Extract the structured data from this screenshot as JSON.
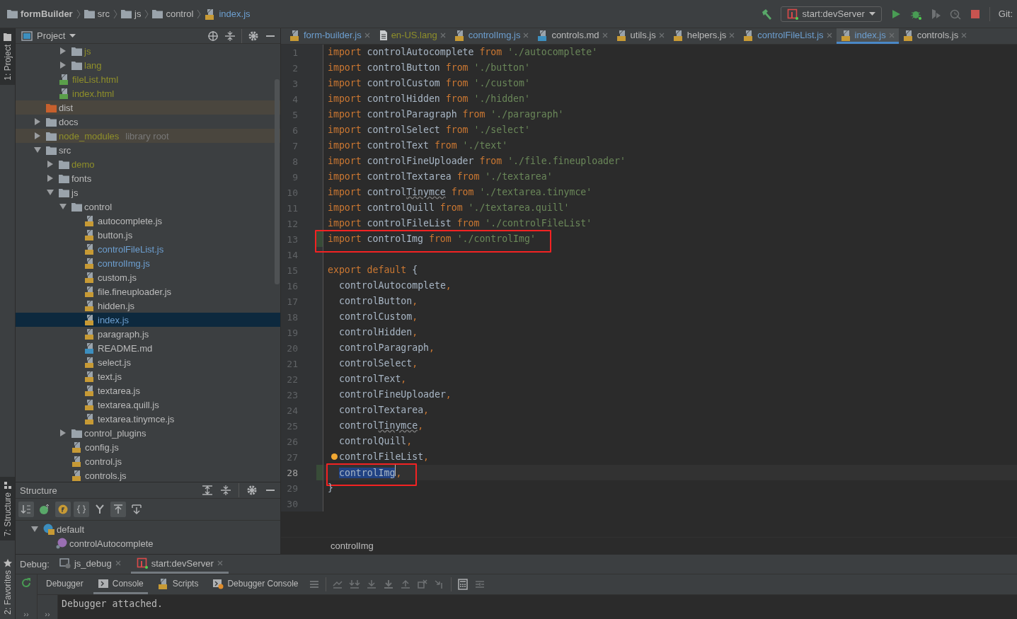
{
  "breadcrumbs": [
    {
      "label": "formBuilder",
      "kind": "project"
    },
    {
      "label": "src",
      "kind": "folder"
    },
    {
      "label": "js",
      "kind": "folder"
    },
    {
      "label": "control",
      "kind": "folder"
    },
    {
      "label": "index.js",
      "kind": "js"
    }
  ],
  "run_config": {
    "label": "start:devServer"
  },
  "vcs": {
    "label": "Git:"
  },
  "left_strip": {
    "top": [
      {
        "label": "1: Project",
        "selected": true
      }
    ],
    "bottom": [
      {
        "label": "7: Structure",
        "selected": true
      },
      {
        "label": "2: Favorites",
        "selected": false
      }
    ]
  },
  "project_panel": {
    "title": "Project",
    "tree": [
      {
        "children": [
          {
            "children": [
              {
                "label": "js",
                "kind": "folder",
                "color": "#8f8f2a",
                "expanded": false,
                "selected": false
              },
              {
                "label": "lang",
                "kind": "folder",
                "color": "#8f8f2a",
                "expanded": false,
                "selected": false
              }
            ]
          },
          {
            "label": "fileList.html",
            "kind": "html",
            "color": "#8f8f2a",
            "selected": false
          },
          {
            "label": "index.html",
            "kind": "html",
            "color": "#8f8f2a",
            "selected": false
          }
        ]
      },
      {
        "label": "dist",
        "kind": "output_folder",
        "color": "#bbbbbb",
        "excluded": true,
        "selected": false
      },
      {
        "label": "docs",
        "kind": "folder",
        "color": "#bbbbbb",
        "excluded": false,
        "expanded": false,
        "selected": false
      },
      {
        "label": "node_modules",
        "note": "library root",
        "kind": "folder",
        "color": "#8f8f2a",
        "excluded": true,
        "expanded": false,
        "selected": false
      },
      {
        "label": "src",
        "kind": "folder",
        "color": "#bbbbbb",
        "excluded": false,
        "expanded": true,
        "selected": false,
        "children": [
          {
            "label": "demo",
            "kind": "folder",
            "color": "#8f8f2a",
            "expanded": false,
            "selected": false
          },
          {
            "label": "fonts",
            "kind": "folder",
            "color": "#bbbbbb",
            "expanded": false,
            "selected": false
          },
          {
            "label": "js",
            "kind": "folder",
            "color": "#bbbbbb",
            "expanded": true,
            "selected": false,
            "children": [
              {
                "label": "control",
                "kind": "folder",
                "color": "#bbbbbb",
                "expanded": true,
                "selected": false,
                "children": [
                  {
                    "label": "autocomplete.js",
                    "kind": "js",
                    "color": "#bbbbbb",
                    "selected": false
                  },
                  {
                    "label": "button.js",
                    "kind": "js",
                    "color": "#bbbbbb",
                    "selected": false
                  },
                  {
                    "label": "controlFileList.js",
                    "kind": "js",
                    "color": "#6d9fd0",
                    "selected": false
                  },
                  {
                    "label": "controlImg.js",
                    "kind": "js",
                    "color": "#6d9fd0",
                    "selected": false
                  },
                  {
                    "label": "custom.js",
                    "kind": "js",
                    "color": "#bbbbbb",
                    "selected": false
                  },
                  {
                    "label": "file.fineuploader.js",
                    "kind": "js",
                    "color": "#bbbbbb",
                    "selected": false
                  },
                  {
                    "label": "hidden.js",
                    "kind": "js",
                    "color": "#bbbbbb",
                    "selected": false
                  },
                  {
                    "label": "index.js",
                    "kind": "js",
                    "color": "#6d9fd0",
                    "selected": true
                  },
                  {
                    "label": "paragraph.js",
                    "kind": "js",
                    "color": "#bbbbbb",
                    "selected": false
                  },
                  {
                    "label": "README.md",
                    "kind": "md",
                    "color": "#bbbbbb",
                    "selected": false
                  },
                  {
                    "label": "select.js",
                    "kind": "js",
                    "color": "#bbbbbb",
                    "selected": false
                  },
                  {
                    "label": "text.js",
                    "kind": "js",
                    "color": "#bbbbbb",
                    "selected": false
                  },
                  {
                    "label": "textarea.js",
                    "kind": "js",
                    "color": "#bbbbbb",
                    "selected": false
                  },
                  {
                    "label": "textarea.quill.js",
                    "kind": "js",
                    "color": "#bbbbbb",
                    "selected": false
                  },
                  {
                    "label": "textarea.tinymce.js",
                    "kind": "js",
                    "color": "#bbbbbb",
                    "selected": false
                  }
                ]
              },
              {
                "label": "control_plugins",
                "kind": "folder",
                "color": "#bbbbbb",
                "expanded": false,
                "selected": false
              },
              {
                "label": "config.js",
                "kind": "js",
                "color": "#bbbbbb",
                "selected": false
              },
              {
                "label": "control.js",
                "kind": "js",
                "color": "#bbbbbb",
                "selected": false
              },
              {
                "label": "controls.js",
                "kind": "js",
                "color": "#bbbbbb",
                "selected": false
              }
            ]
          }
        ]
      }
    ]
  },
  "structure_panel": {
    "title": "Structure",
    "toggles": [
      {
        "kind": "sort",
        "on": true
      },
      {
        "kind": "inherited",
        "on": false
      },
      {
        "kind": "fields",
        "on": true
      },
      {
        "kind": "braces",
        "on": true
      },
      {
        "kind": "fork",
        "on": false
      },
      {
        "kind": "scroll_to",
        "on": true
      },
      {
        "kind": "scroll_from",
        "on": false
      }
    ],
    "tree": [
      {
        "label": "default",
        "kind": "object",
        "expanded": true,
        "children": [
          {
            "label": "controlAutocomplete",
            "kind": "property"
          }
        ]
      }
    ]
  },
  "tabs": [
    {
      "label": "form-builder.js",
      "kind": "js",
      "color": "#6d9fd0",
      "selected": false
    },
    {
      "label": "en-US.lang",
      "kind": "text",
      "color": "#8f8f2a",
      "selected": false
    },
    {
      "label": "controlImg.js",
      "kind": "js",
      "color": "#6d9fd0",
      "selected": false
    },
    {
      "label": "controls.md",
      "kind": "md",
      "color": "#bbbbbb",
      "selected": false
    },
    {
      "label": "utils.js",
      "kind": "js",
      "color": "#bbbbbb",
      "selected": false
    },
    {
      "label": "helpers.js",
      "kind": "js",
      "color": "#bbbbbb",
      "selected": false
    },
    {
      "label": "controlFileList.js",
      "kind": "js",
      "color": "#6d9fd0",
      "selected": false
    },
    {
      "label": "index.js",
      "kind": "js",
      "color": "#6d9fd0",
      "selected": true
    },
    {
      "label": "controls.js",
      "kind": "js",
      "color": "#bbbbbb",
      "selected": false
    }
  ],
  "editor": {
    "lines": [
      {
        "number": "1",
        "current": false,
        "changed": false,
        "annotated": false,
        "bulb": false,
        "indented": false,
        "tokens": [
          {
            "kind": "keyword",
            "text": "import"
          },
          {
            "kind": "name",
            "text": "controlAutocomplete"
          },
          {
            "kind": "keyword",
            "text": "from"
          },
          {
            "kind": "string",
            "text": "'./autocomplete'"
          }
        ]
      },
      {
        "number": "2",
        "current": false,
        "changed": false,
        "annotated": false,
        "bulb": false,
        "indented": false,
        "tokens": [
          {
            "kind": "keyword",
            "text": "import"
          },
          {
            "kind": "name",
            "text": "controlButton"
          },
          {
            "kind": "keyword",
            "text": "from"
          },
          {
            "kind": "string",
            "text": "'./button'"
          }
        ]
      },
      {
        "number": "3",
        "current": false,
        "changed": false,
        "annotated": false,
        "bulb": false,
        "indented": false,
        "tokens": [
          {
            "kind": "keyword",
            "text": "import"
          },
          {
            "kind": "name",
            "text": "controlCustom"
          },
          {
            "kind": "keyword",
            "text": "from"
          },
          {
            "kind": "string",
            "text": "'./custom'"
          }
        ]
      },
      {
        "number": "4",
        "current": false,
        "changed": false,
        "annotated": false,
        "bulb": false,
        "indented": false,
        "tokens": [
          {
            "kind": "keyword",
            "text": "import"
          },
          {
            "kind": "name",
            "text": "controlHidden"
          },
          {
            "kind": "keyword",
            "text": "from"
          },
          {
            "kind": "string",
            "text": "'./hidden'"
          }
        ]
      },
      {
        "number": "5",
        "current": false,
        "changed": false,
        "annotated": false,
        "bulb": false,
        "indented": false,
        "tokens": [
          {
            "kind": "keyword",
            "text": "import"
          },
          {
            "kind": "name",
            "text": "controlParagraph"
          },
          {
            "kind": "keyword",
            "text": "from"
          },
          {
            "kind": "string",
            "text": "'./paragraph'"
          }
        ]
      },
      {
        "number": "6",
        "current": false,
        "changed": false,
        "annotated": false,
        "bulb": false,
        "indented": false,
        "tokens": [
          {
            "kind": "keyword",
            "text": "import"
          },
          {
            "kind": "name",
            "text": "controlSelect"
          },
          {
            "kind": "keyword",
            "text": "from"
          },
          {
            "kind": "string",
            "text": "'./select'"
          }
        ]
      },
      {
        "number": "7",
        "current": false,
        "changed": false,
        "annotated": false,
        "bulb": false,
        "indented": false,
        "tokens": [
          {
            "kind": "keyword",
            "text": "import"
          },
          {
            "kind": "name",
            "text": "controlText"
          },
          {
            "kind": "keyword",
            "text": "from"
          },
          {
            "kind": "string",
            "text": "'./text'"
          }
        ]
      },
      {
        "number": "8",
        "current": false,
        "changed": false,
        "annotated": false,
        "bulb": false,
        "indented": false,
        "tokens": [
          {
            "kind": "keyword",
            "text": "import"
          },
          {
            "kind": "name",
            "text": "controlFineUploader"
          },
          {
            "kind": "keyword",
            "text": "from"
          },
          {
            "kind": "string",
            "text": "'./file.fineuploader'"
          }
        ]
      },
      {
        "number": "9",
        "current": false,
        "changed": false,
        "annotated": false,
        "bulb": false,
        "indented": false,
        "tokens": [
          {
            "kind": "keyword",
            "text": "import"
          },
          {
            "kind": "name",
            "text": "controlTextarea"
          },
          {
            "kind": "keyword",
            "text": "from"
          },
          {
            "kind": "string",
            "text": "'./textarea'"
          }
        ]
      },
      {
        "number": "10",
        "current": false,
        "changed": false,
        "annotated": false,
        "bulb": false,
        "indented": false,
        "tokens": [
          {
            "kind": "keyword",
            "text": "import"
          },
          {
            "kind": "name",
            "text": "control"
          },
          {
            "kind": "name",
            "text": "Tinymce",
            "typo": true
          },
          {
            "kind": "keyword",
            "text": "from"
          },
          {
            "kind": "string",
            "text": "'./textarea.tinymce'"
          }
        ]
      },
      {
        "number": "11",
        "current": false,
        "changed": false,
        "annotated": false,
        "bulb": false,
        "indented": false,
        "tokens": [
          {
            "kind": "keyword",
            "text": "import"
          },
          {
            "kind": "name",
            "text": "controlQuill"
          },
          {
            "kind": "keyword",
            "text": "from"
          },
          {
            "kind": "string",
            "text": "'./textarea.quill'"
          }
        ]
      },
      {
        "number": "12",
        "current": false,
        "changed": false,
        "annotated": false,
        "bulb": false,
        "indented": false,
        "tokens": [
          {
            "kind": "keyword",
            "text": "import"
          },
          {
            "kind": "name",
            "text": "controlFileList"
          },
          {
            "kind": "keyword",
            "text": "from"
          },
          {
            "kind": "string",
            "text": "'./controlFileList'"
          }
        ]
      },
      {
        "number": "13",
        "current": false,
        "changed": true,
        "annotated": true,
        "bulb": false,
        "indented": false,
        "tokens": [
          {
            "kind": "keyword",
            "text": "import"
          },
          {
            "kind": "name",
            "text": "controlImg"
          },
          {
            "kind": "keyword",
            "text": "from"
          },
          {
            "kind": "string",
            "text": "'./controlImg'"
          }
        ]
      },
      {
        "number": "14",
        "current": false,
        "changed": false
      },
      {
        "number": "15",
        "current": false,
        "changed": false,
        "annotated": false,
        "bulb": false,
        "indented": false,
        "tokens": [
          {
            "kind": "keyword",
            "text": "export"
          },
          {
            "kind": "keyword",
            "text": "default"
          },
          {
            "kind": "name",
            "text": "{"
          }
        ]
      },
      {
        "number": "16",
        "current": false,
        "changed": false,
        "annotated": false,
        "bulb": false,
        "indented": true,
        "tokens": [
          {
            "kind": "name",
            "text": "controlAutocomplete"
          },
          {
            "kind": "comma",
            "text": ","
          }
        ]
      },
      {
        "number": "17",
        "current": false,
        "changed": false,
        "annotated": false,
        "bulb": false,
        "indented": true,
        "tokens": [
          {
            "kind": "name",
            "text": "controlButton"
          },
          {
            "kind": "comma",
            "text": ","
          }
        ]
      },
      {
        "number": "18",
        "current": false,
        "changed": false,
        "annotated": false,
        "bulb": false,
        "indented": true,
        "tokens": [
          {
            "kind": "name",
            "text": "controlCustom"
          },
          {
            "kind": "comma",
            "text": ","
          }
        ]
      },
      {
        "number": "19",
        "current": false,
        "changed": false,
        "annotated": false,
        "bulb": false,
        "indented": true,
        "tokens": [
          {
            "kind": "name",
            "text": "controlHidden"
          },
          {
            "kind": "comma",
            "text": ","
          }
        ]
      },
      {
        "number": "20",
        "current": false,
        "changed": false,
        "annotated": false,
        "bulb": false,
        "indented": true,
        "tokens": [
          {
            "kind": "name",
            "text": "controlParagraph"
          },
          {
            "kind": "comma",
            "text": ","
          }
        ]
      },
      {
        "number": "21",
        "current": false,
        "changed": false,
        "annotated": false,
        "bulb": false,
        "indented": true,
        "tokens": [
          {
            "kind": "name",
            "text": "controlSelect"
          },
          {
            "kind": "comma",
            "text": ","
          }
        ]
      },
      {
        "number": "22",
        "current": false,
        "changed": false,
        "annotated": false,
        "bulb": false,
        "indented": true,
        "tokens": [
          {
            "kind": "name",
            "text": "controlText"
          },
          {
            "kind": "comma",
            "text": ","
          }
        ]
      },
      {
        "number": "23",
        "current": false,
        "changed": false,
        "annotated": false,
        "bulb": false,
        "indented": true,
        "tokens": [
          {
            "kind": "name",
            "text": "controlFineUploader"
          },
          {
            "kind": "comma",
            "text": ","
          }
        ]
      },
      {
        "number": "24",
        "current": false,
        "changed": false,
        "annotated": false,
        "bulb": false,
        "indented": true,
        "tokens": [
          {
            "kind": "name",
            "text": "controlTextarea"
          },
          {
            "kind": "comma",
            "text": ","
          }
        ]
      },
      {
        "number": "25",
        "current": false,
        "changed": false,
        "annotated": false,
        "bulb": false,
        "indented": true,
        "tokens": [
          {
            "kind": "name",
            "text": "control"
          },
          {
            "kind": "name",
            "text": "Tinymce",
            "typo": true
          },
          {
            "kind": "comma",
            "text": ","
          }
        ]
      },
      {
        "number": "26",
        "current": false,
        "changed": false,
        "annotated": false,
        "bulb": false,
        "indented": true,
        "tokens": [
          {
            "kind": "name",
            "text": "controlQuill"
          },
          {
            "kind": "comma",
            "text": ","
          }
        ]
      },
      {
        "number": "27",
        "current": false,
        "changed": false,
        "annotated": false,
        "bulb": true,
        "indented": true,
        "tokens": [
          {
            "kind": "name",
            "text": "controlFileList"
          },
          {
            "kind": "comma",
            "text": ","
          }
        ]
      },
      {
        "number": "28",
        "current": true,
        "changed": true,
        "annotated": true,
        "bulb": false,
        "indented": true,
        "tokens": [
          {
            "kind": "name",
            "text": "controlImg",
            "selected": true
          },
          {
            "kind": "comma",
            "text": ","
          }
        ]
      },
      {
        "number": "29",
        "current": false,
        "changed": false,
        "annotated": false,
        "bulb": false,
        "indented": false,
        "tokens": [
          {
            "kind": "name",
            "text": "}"
          }
        ]
      },
      {
        "number": "30",
        "current": false,
        "changed": false
      }
    ],
    "breadcrumb": "controlImg"
  },
  "debug": {
    "title": "Debug:",
    "tabs": [
      {
        "label": "js_debug",
        "kind": "js_debug",
        "selected": false
      },
      {
        "label": "start:devServer",
        "kind": "npm",
        "selected": true
      }
    ],
    "subtabs": [
      {
        "label": "Debugger",
        "kind": "plain",
        "selected": false
      },
      {
        "label": "Console",
        "kind": "console",
        "selected": true
      },
      {
        "label": "Scripts",
        "kind": "scripts",
        "selected": false
      },
      {
        "label": "Debugger Console",
        "kind": "debug_console",
        "selected": false
      }
    ],
    "more_left": "››",
    "more_right": "››",
    "console": [
      "Debugger attached."
    ]
  }
}
